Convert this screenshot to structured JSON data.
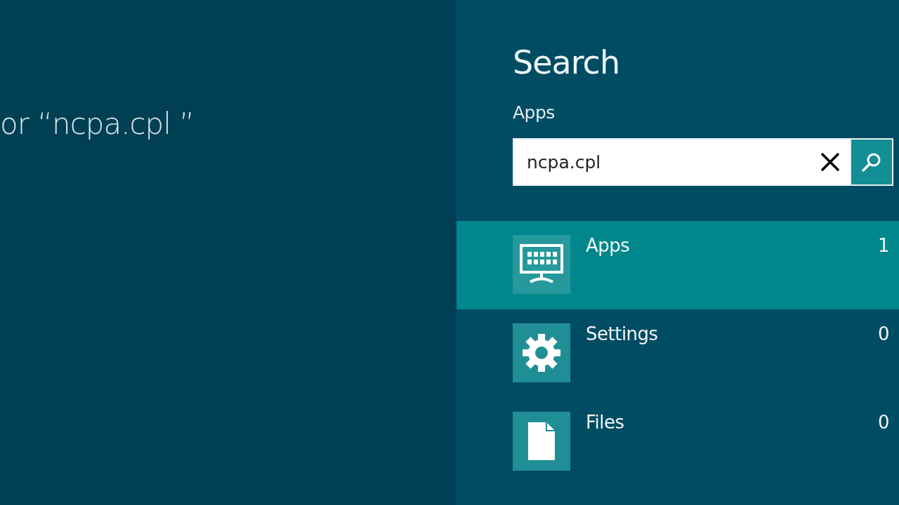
{
  "results_heading": "or “ncpa.cpl ”",
  "search_pane": {
    "title": "Search",
    "scope": "Apps",
    "query": "ncpa.cpl",
    "categories": [
      {
        "kind": "apps",
        "label": "Apps",
        "count": "1",
        "selected": true
      },
      {
        "kind": "settings",
        "label": "Settings",
        "count": "0",
        "selected": false
      },
      {
        "kind": "files",
        "label": "Files",
        "count": "0",
        "selected": false
      }
    ]
  }
}
